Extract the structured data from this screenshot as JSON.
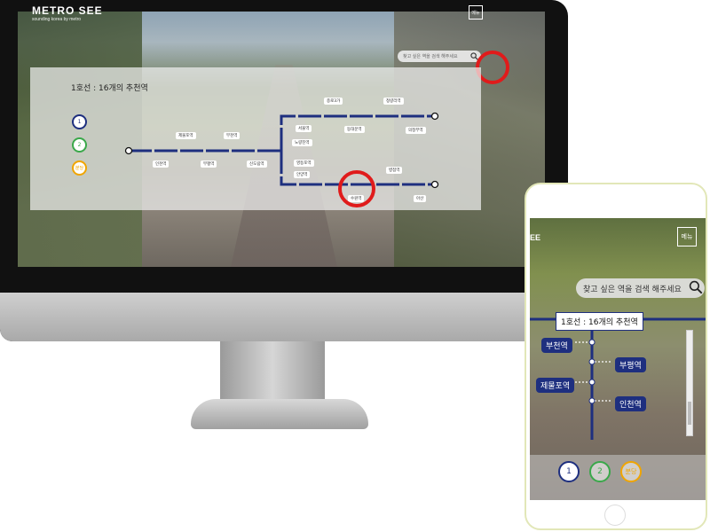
{
  "desktop": {
    "brand": {
      "title": "METRO SEE",
      "subtitle": "sounding korea by metro"
    },
    "menu_label": "메뉴",
    "search_placeholder": "찾고 싶은 역을 검색 해주세요",
    "panel_title": "1호선 : 16개의 추천역",
    "line_buttons": [
      {
        "label": "1",
        "color": "#1e2f7f"
      },
      {
        "label": "2",
        "color": "#3aa84a"
      },
      {
        "label": "분당",
        "color": "#f0a500"
      }
    ],
    "stations": [
      "종로3가",
      "청량리역",
      "제물포역",
      "부천역",
      "서울역",
      "동대문역",
      "의정부역",
      "노량진역",
      "인천역",
      "부평역",
      "신도림역",
      "영등포역",
      "안양역",
      "수원역",
      "병점역",
      "아산"
    ],
    "line_color": "#1e2f7f",
    "highlight_color": "#e01b1b"
  },
  "mobile": {
    "brand": "EE",
    "menu_label": "메뉴",
    "search_placeholder": "찾고 싶은 역을 검색 해주세요",
    "panel_title": "1호선 : 16개의 추천역",
    "stations": [
      "부천역",
      "부평역",
      "제물포역",
      "인천역"
    ],
    "line_buttons": [
      {
        "label": "1",
        "color": "#1e2f7f"
      },
      {
        "label": "2",
        "color": "#3aa84a"
      },
      {
        "label": "분당",
        "color": "#f0a500"
      }
    ]
  }
}
